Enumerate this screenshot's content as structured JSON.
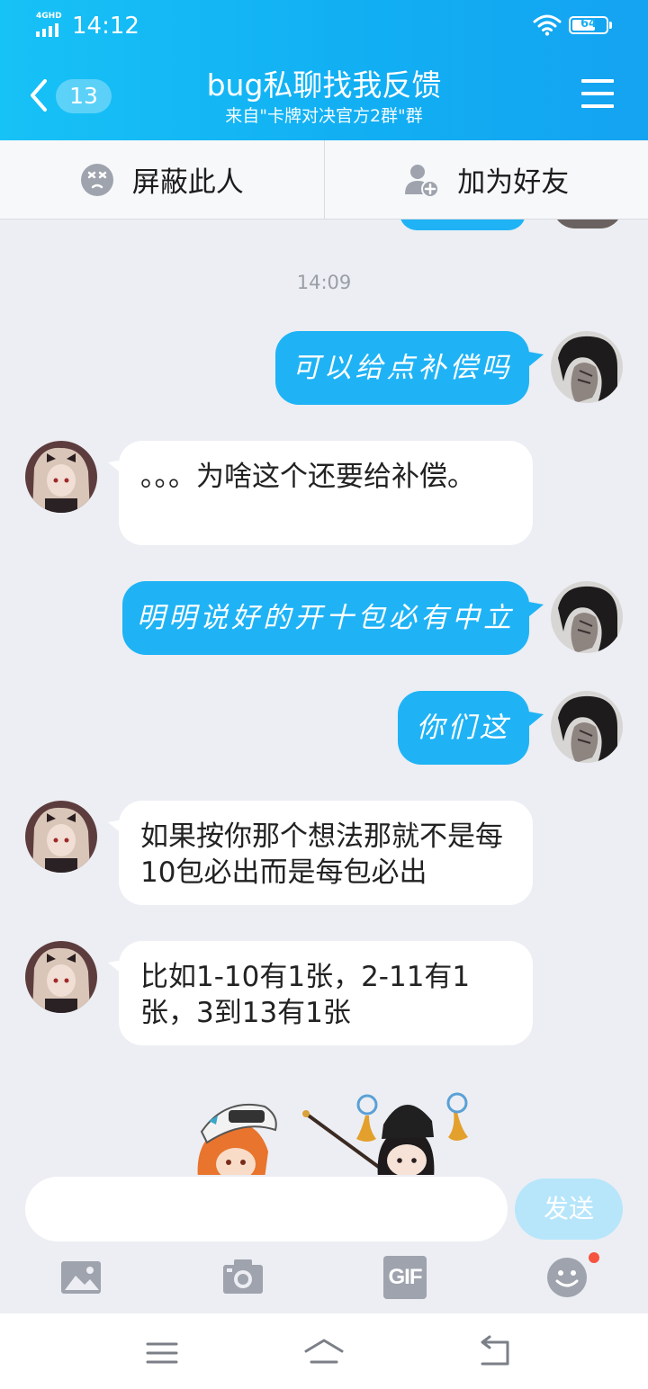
{
  "status_bar": {
    "network": "4GHD",
    "time": "14:12",
    "battery": "64"
  },
  "header": {
    "unread_count": "13",
    "title": "bug私聊找我反馈",
    "subtitle": "来自\"卡牌对决官方2群\"群"
  },
  "actions": {
    "block_label": "屏蔽此人",
    "add_friend_label": "加为好友"
  },
  "chat": {
    "timestamp": "14:09",
    "messages": [
      {
        "from": "me",
        "text": "可以给点补偿吗"
      },
      {
        "from": "other",
        "text": "。。。为啥这个还要给补偿。"
      },
      {
        "from": "me",
        "text": "明明说好的开十包必有中立"
      },
      {
        "from": "me",
        "text": "你们这"
      },
      {
        "from": "other",
        "text": "如果按你那个想法那就不是每10包必出而是每包必出"
      },
      {
        "from": "other",
        "text": "比如1-10有1张，2-11有1张，3到13有1张"
      }
    ]
  },
  "composer": {
    "placeholder": "",
    "send_label": "发送",
    "tools": [
      "image-icon",
      "camera-icon",
      "gif-icon",
      "emoji-icon"
    ],
    "gif_label": "GIF"
  },
  "nav_bar": {
    "icons": [
      "menu-icon",
      "home-icon",
      "back-icon"
    ]
  },
  "colors": {
    "header": "#14a3f1",
    "outgoing_bubble": "#1fb3f6",
    "incoming_bubble": "#ffffff",
    "chat_background": "#eceef3",
    "send_button": "#b7e6fb",
    "notification_dot": "#f5543f"
  }
}
